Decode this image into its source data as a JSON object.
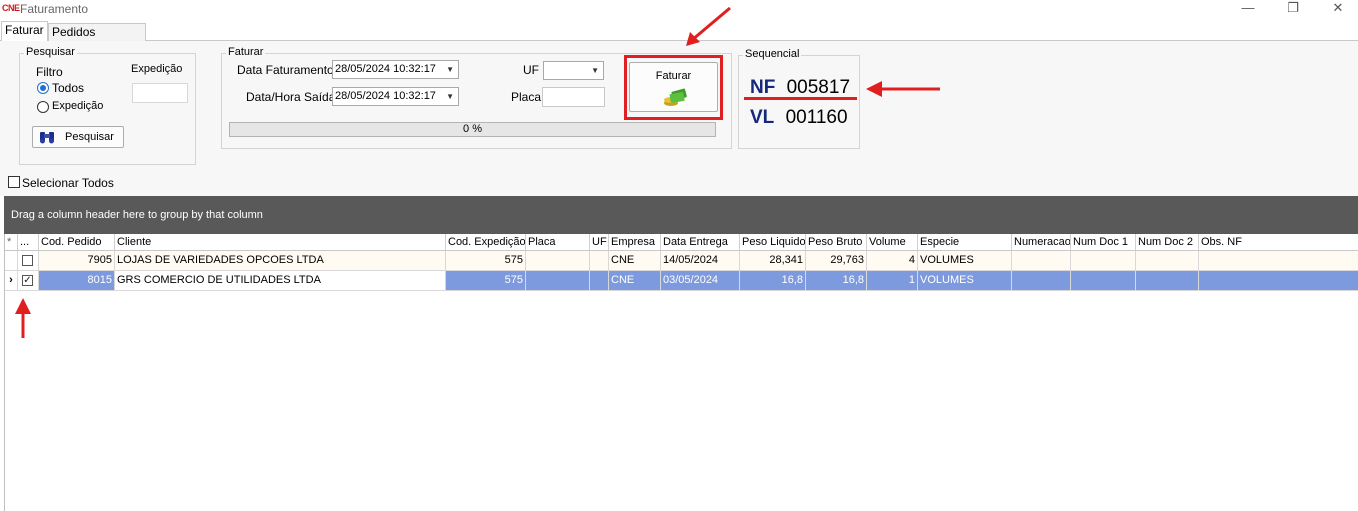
{
  "window": {
    "logo_text": "CNE",
    "title": "Faturamento",
    "minimize": "—",
    "maximize": "❐",
    "close": "✕"
  },
  "tabs": [
    {
      "label": "Faturar",
      "active": true
    },
    {
      "label": "Pedidos Faturados",
      "active": false
    }
  ],
  "pesquisar": {
    "group_title": "Pesquisar",
    "filtro_label": "Filtro",
    "options": [
      {
        "label": "Todos",
        "checked": true
      },
      {
        "label": "Expedição",
        "checked": false
      }
    ],
    "expedicao_label": "Expedição",
    "expedicao_value": "",
    "search_button": "Pesquisar"
  },
  "faturar": {
    "group_title": "Faturar",
    "data_faturamento_label": "Data Faturamento",
    "data_faturamento_value": "28/05/2024 10:32:17",
    "data_saida_label": "Data/Hora Saída",
    "data_saida_value": "28/05/2024 10:32:17",
    "uf_label": "UF",
    "uf_value": "",
    "placa_label": "Placa",
    "placa_value": "",
    "button_label": "Faturar",
    "progress_text": "0 %",
    "progress_value": 0
  },
  "sequencial": {
    "group_title": "Sequencial",
    "nf_label": "NF",
    "nf_value": "005817",
    "vl_label": "VL",
    "vl_value": "001160"
  },
  "select_all_label": "Selecionar Todos",
  "group_bar_text": "Drag a column header here to group by that column",
  "grid": {
    "columns": [
      "*",
      "...",
      "Cod. Pedido",
      "Cliente",
      "Cod. Expedição",
      "Placa",
      "UF",
      "Empresa",
      "Data Entrega",
      "Peso Liquido",
      "Peso Bruto",
      "Volume",
      "Especie",
      "Numeracao",
      "Num Doc 1",
      "Num Doc 2",
      "Obs. NF"
    ],
    "rows": [
      {
        "indicator": "",
        "checked": false,
        "cod_pedido": "7905",
        "cliente": "LOJAS DE VARIEDADES OPCOES LTDA",
        "cod_expedicao": "575",
        "placa": "",
        "uf": "",
        "empresa": "CNE",
        "data_entrega": "14/05/2024",
        "peso_liquido": "28,341",
        "peso_bruto": "29,763",
        "volume": "4",
        "especie": "VOLUMES",
        "numeracao": "",
        "num_doc1": "",
        "num_doc2": "",
        "obs_nf": ""
      },
      {
        "indicator": "›",
        "checked": true,
        "cod_pedido": "8015",
        "cliente": "GRS COMERCIO DE UTILIDADES LTDA",
        "cod_expedicao": "575",
        "placa": "",
        "uf": "",
        "empresa": "CNE",
        "data_entrega": "03/05/2024",
        "peso_liquido": "16,8",
        "peso_bruto": "16,8",
        "volume": "1",
        "especie": "VOLUMES",
        "numeracao": "",
        "num_doc1": "",
        "num_doc2": "",
        "obs_nf": ""
      }
    ]
  },
  "colors": {
    "accent_red": "#e02020",
    "selected_row": "#7e9ade",
    "seq_text": "#15287a",
    "group_bar": "#595959"
  }
}
